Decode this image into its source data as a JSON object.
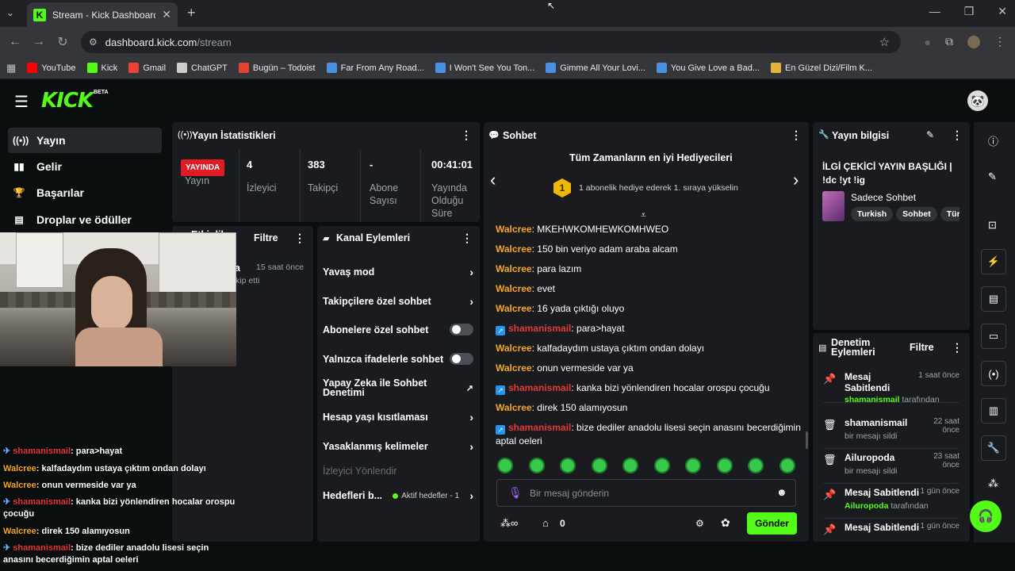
{
  "browser": {
    "tab_title": "Stream - Kick Dashboard",
    "new_tab": "+",
    "url_host": "dashboard.kick.com",
    "url_path": "/stream",
    "bookmarks": [
      {
        "label": "YouTube",
        "color": "#ff0000"
      },
      {
        "label": "Kick",
        "color": "#53fc18"
      },
      {
        "label": "Gmail",
        "color": "#ea4335"
      },
      {
        "label": "ChatGPT",
        "color": "#cccccc"
      },
      {
        "label": "Bugün – Todoist",
        "color": "#e44332"
      },
      {
        "label": "Far From Any Road...",
        "color": "#4a90e2"
      },
      {
        "label": "I Won't See You Ton...",
        "color": "#4a90e2"
      },
      {
        "label": "Gimme All Your Lovi...",
        "color": "#4a90e2"
      },
      {
        "label": "You Give Love a Bad...",
        "color": "#4a90e2"
      },
      {
        "label": "En Güzel Dizi/Film K...",
        "color": "#e2b33c"
      }
    ]
  },
  "brand": {
    "logo": "KICK",
    "beta": "BETA",
    "accent": "#53fc18"
  },
  "sidebar": {
    "items": [
      {
        "label": "Yayın",
        "icon": "broadcast-icon"
      },
      {
        "label": "Gelir",
        "icon": "chart-icon"
      },
      {
        "label": "Başarılar",
        "icon": "trophy-icon"
      },
      {
        "label": "Droplar ve ödüller",
        "icon": "gift-icon"
      }
    ]
  },
  "stats": {
    "title": "Yayın İstatistikleri",
    "live_badge": "YAYINDA",
    "stream_label": "Yayın",
    "viewers_value": "4",
    "viewers_label": "İzleyici",
    "followers_value": "383",
    "followers_label": "Takipçi",
    "subs_value": "-",
    "subs_label": "Abone Sayısı",
    "uptime_value": "00:41:01",
    "uptime_label": "Yayında Olduğu Süre"
  },
  "activity": {
    "title": "Etkinlik",
    "filter": "Filtre",
    "item_user_fragment": "aa",
    "item_time": "15 saat önce",
    "item_text": "kip etti"
  },
  "channel_actions": {
    "title": "Kanal Eylemleri",
    "slow_mode": "Yavaş mod",
    "followers_only": "Takipçilere özel sohbet",
    "subs_only": "Abonelere özel sohbet",
    "emotes_only": "Yalnızca ifadelerle sohbet",
    "ai_moderation": "Yapay Zeka ile Sohbet Denetimi",
    "account_age": "Hesap yaşı kısıtlaması",
    "banned_words": "Yasaklanmış kelimeler",
    "redirect_viewers": "İzleyici Yönlendir",
    "goals": "Hedefleri b...",
    "goals_status": "Aktif hedefler - 1"
  },
  "chat": {
    "title": "Sohbet",
    "gifters_title": "Tüm Zamanların en iyi Hediyecileri",
    "gifters_rank": "1",
    "gifters_text": "1 abonelik hediye ederek 1. sıraya yükselin",
    "messages": [
      {
        "user": "Walcree",
        "text": "MKEHWKOMHEWKOMHWEO",
        "badge": false
      },
      {
        "user": "Walcree",
        "text": "150 bin veriyo adam araba alcam",
        "badge": false
      },
      {
        "user": "Walcree",
        "text": "para lazım",
        "badge": false
      },
      {
        "user": "Walcree",
        "text": "evet",
        "badge": false
      },
      {
        "user": "Walcree",
        "text": "16 yada çıktığı oluyo",
        "badge": false
      },
      {
        "user": "shamanismail",
        "text": "para>hayat",
        "badge": true
      },
      {
        "user": "Walcree",
        "text": "kalfadaydım ustaya çıktım ondan dolayı",
        "badge": false
      },
      {
        "user": "Walcree",
        "text": "onun vermeside var ya",
        "badge": false
      },
      {
        "user": "shamanismail",
        "text": "kanka bizi yönlendiren hocalar orospu çocuğu",
        "badge": true
      },
      {
        "user": "Walcree",
        "text": "direk 150 alamıyosun",
        "badge": false
      },
      {
        "user": "shamanismail",
        "text": "bize dediler anadolu lisesi seçin anasını becerdiğimin aptal oeleri",
        "badge": true
      }
    ],
    "input_placeholder": "Bir mesaj gönderin",
    "points": "0",
    "send": "Gönder"
  },
  "overlay_chat": [
    {
      "user": "shamanismail",
      "text": "para>hayat",
      "badge": true
    },
    {
      "user": "Walcree",
      "text": "kalfadaydım ustaya çıktım ondan dolayı",
      "badge": false
    },
    {
      "user": "Walcree",
      "text": "onun vermeside var ya",
      "badge": false
    },
    {
      "user": "shamanismail",
      "text": "kanka bizi yönlendiren hocalar orospu çocuğu",
      "badge": true
    },
    {
      "user": "Walcree",
      "text": "direk 150 alamıyosun",
      "badge": false
    },
    {
      "user": "shamanismail",
      "text": "bize dediler anadolu lisesi seçin anasını becerdiğimin aptal oeleri",
      "badge": true
    }
  ],
  "stream_info": {
    "title": "Yayın bilgisi",
    "stream_title": "İLGİ ÇEKİCİ YAYIN BAŞLIĞI | !dc !yt !ig",
    "category": "Sadece Sohbet",
    "tags": [
      "Turkish",
      "Sohbet",
      "Türk"
    ]
  },
  "moderation": {
    "title": "Denetim Eylemleri",
    "filter": "Filtre",
    "items": [
      {
        "icon": "pin-icon",
        "title": "Mesaj Sabitlendi",
        "sub_user": "shamanismail",
        "sub_text": " tarafından",
        "time": "1 saat önce"
      },
      {
        "icon": "trash-icon",
        "title": "shamanismail",
        "sub_user": "",
        "sub_text": "bir mesajı sildi",
        "time": "22 saat önce"
      },
      {
        "icon": "trash-icon",
        "title": "Ailuropoda",
        "sub_user": "",
        "sub_text": "bir mesajı sildi",
        "time": "23 saat önce"
      },
      {
        "icon": "pin-icon",
        "title": "Mesaj Sabitlendi",
        "sub_user": "Ailuropoda",
        "sub_text": " tarafından",
        "time": "1 gün önce"
      },
      {
        "icon": "pin-icon",
        "title": "Mesaj Sabitlendi",
        "sub_user": "",
        "sub_text": "",
        "time": "1 gün önce"
      }
    ]
  }
}
